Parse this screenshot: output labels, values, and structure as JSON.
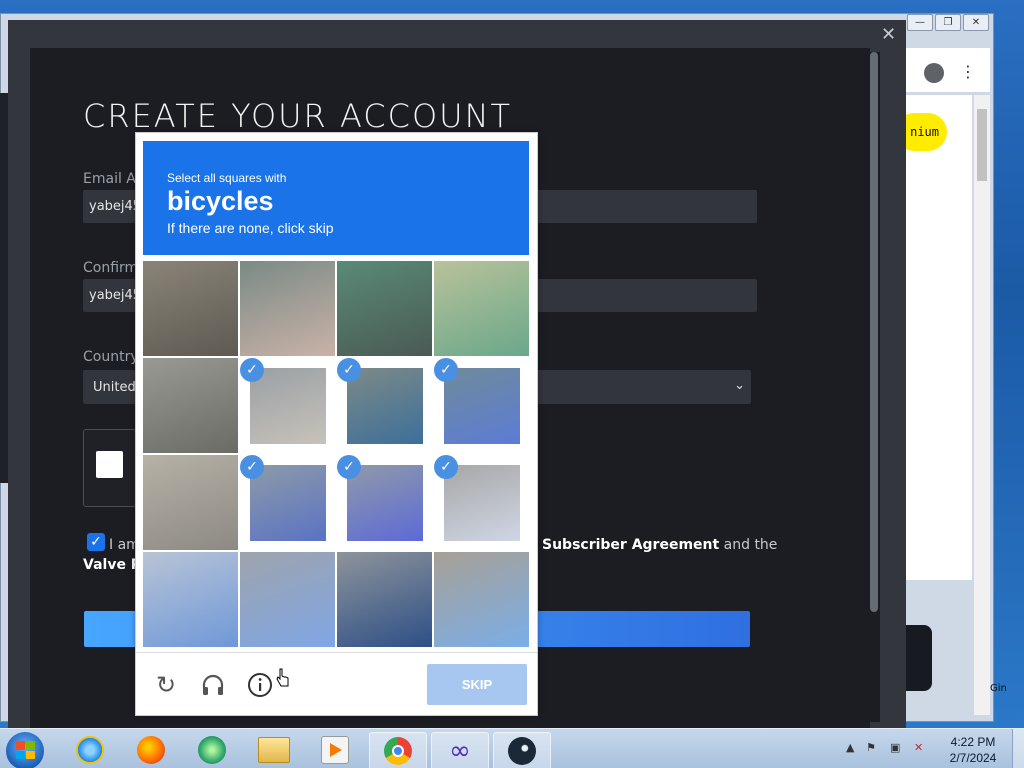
{
  "bg_browser": {
    "pill_text": "nium",
    "partial_text": "Gin"
  },
  "steam": {
    "title": "CREATE YOUR ACCOUNT",
    "email_label": "Email Ac",
    "email_value": "yabej45",
    "confirm_label": "Confirm",
    "confirm_value": "yabej45",
    "country_label": "Country",
    "country_value": "United",
    "agree_prefix": "I am",
    "agree_link": "Subscriber Agreement",
    "agree_suffix": " and the",
    "valve_text": "Valve Pr",
    "agree_checked": true
  },
  "recaptcha": {
    "instruction": "Select all squares with",
    "target": "bicycles",
    "hint": "If there are none, click skip",
    "skip_label": "SKIP",
    "selected_tiles": [
      5,
      6,
      7,
      9,
      10,
      11
    ],
    "icons": [
      "reload-icon",
      "audio-icon",
      "info-icon"
    ]
  },
  "taskbar": {
    "apps": [
      "internet-explorer",
      "firefox",
      "app-green",
      "file-explorer",
      "media-player",
      "chrome",
      "infinity-app",
      "steam"
    ],
    "time": "4:22 PM",
    "date": "2/7/2024"
  }
}
